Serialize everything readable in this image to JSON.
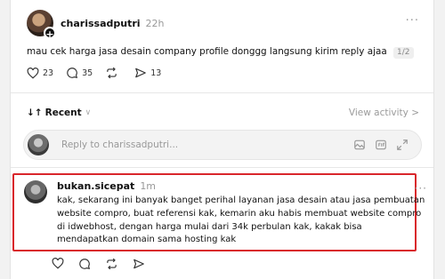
{
  "post": {
    "username": "charissadputri",
    "time": "22h",
    "text": "mau cek harga jasa desain company profile donggg langsung kirim reply ajaa",
    "page_indicator": "1/2",
    "likes": "23",
    "replies": "35",
    "shares": "13"
  },
  "sort": {
    "label": "Recent"
  },
  "view_activity": "View activity >",
  "reply_box": {
    "placeholder": "Reply to charissadputri..."
  },
  "comment": {
    "username": "bukan.sicepat",
    "time": "1m",
    "lines": [
      "kak, sekarang ini banyak banget perihal layanan jasa desain atau jasa pembuatan",
      "website compro, buat referensi kak, kemarin aku habis membuat website compro",
      "di idwebhost, dengan harga mulai dari 34k perbulan kak, kakak bisa",
      "mendapatkan domain sama hosting kak"
    ]
  },
  "icons": [
    "heart-icon",
    "comment-icon",
    "repost-icon",
    "share-icon",
    "more-icon",
    "sort-icon",
    "image-icon",
    "gif-icon",
    "expand-icon"
  ]
}
